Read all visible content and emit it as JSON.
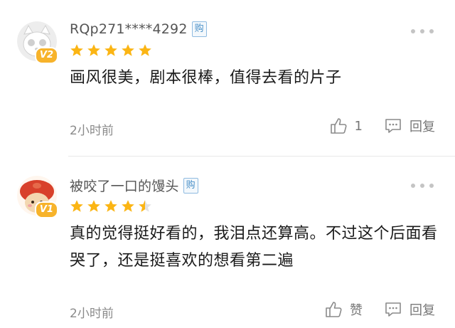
{
  "comments": [
    {
      "username": "RQp271****4292",
      "buy_tag": "购",
      "level": "V2",
      "rating": 5,
      "content": "画风很美，剧本很棒，值得去看的片子",
      "time": "2小时前",
      "like_count": "1",
      "reply_label": "回复"
    },
    {
      "username": "被咬了一口的馒头",
      "buy_tag": "购",
      "level": "V1",
      "rating": 4.5,
      "content": "真的觉得挺好看的，我泪点还算高。不过这个后面看哭了，还是挺喜欢的想看第二遍",
      "time": "2小时前",
      "like_label": "赞",
      "reply_label": "回复"
    }
  ],
  "colors": {
    "star": "#fbb514",
    "star_empty": "#e2e2e2",
    "buy_tag": "#4a90c8",
    "level_badge": "#f7b32b"
  }
}
